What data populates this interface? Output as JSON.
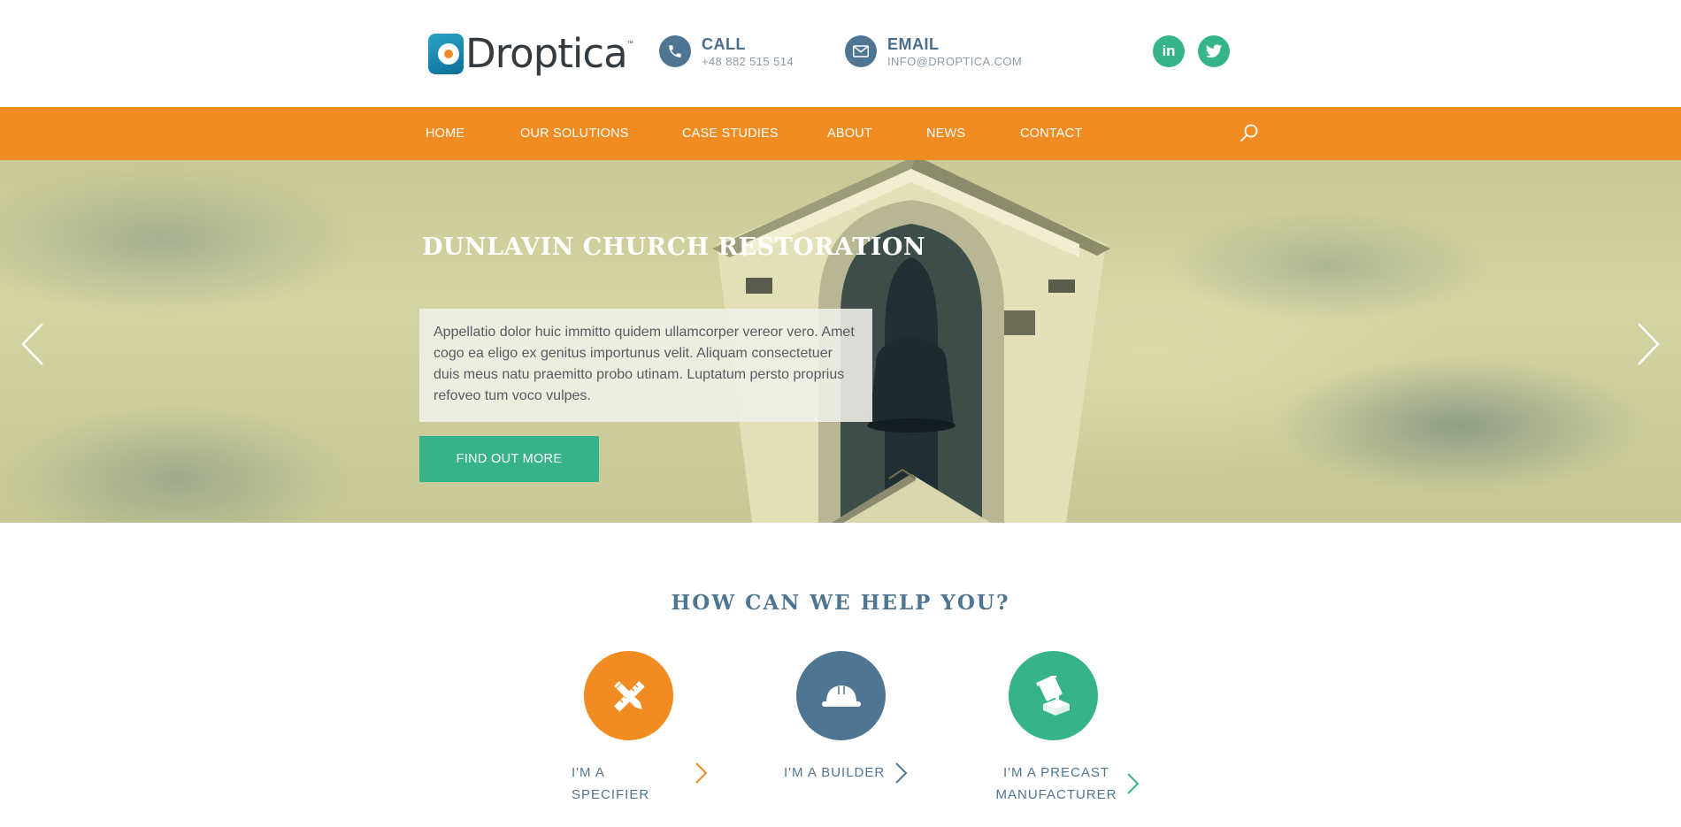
{
  "header": {
    "brand": "Droptica",
    "brand_tm": "™",
    "call": {
      "label": "CALL",
      "value": "+48 882 515 514",
      "icon": "phone-icon"
    },
    "email": {
      "label": "EMAIL",
      "value": "INFO@DROPTICA.COM",
      "icon": "envelope-icon"
    },
    "social": [
      {
        "name": "linkedin",
        "glyph": "in",
        "icon": "linkedin-icon"
      },
      {
        "name": "twitter",
        "icon": "twitter-icon"
      }
    ]
  },
  "nav": {
    "items": [
      {
        "label": "HOME"
      },
      {
        "label": "OUR SOLUTIONS"
      },
      {
        "label": "CASE STUDIES"
      },
      {
        "label": "ABOUT"
      },
      {
        "label": "NEWS"
      },
      {
        "label": "CONTACT"
      }
    ],
    "search_icon": "search-icon"
  },
  "hero": {
    "title": "DUNLAVIN CHURCH RESTORATION",
    "description": "Appellatio dolor huic immitto quidem ullamcorper vereor vero. Amet cogo ea eligo ex genitus importunus velit. Aliquam consectetuer duis meus natu praemitto probo utinam. Luptatum persto proprius refoveo tum voco vulpes.",
    "button_label": "FIND OUT MORE",
    "prev_icon": "chevron-left-icon",
    "next_icon": "chevron-right-icon"
  },
  "help": {
    "title": "HOW CAN WE HELP YOU?",
    "options": [
      {
        "line1": "I'M A SPECIFIER",
        "line2": "",
        "icon": "pencil-ruler-icon",
        "color": "#f08c22"
      },
      {
        "line1": "I'M A BUILDER",
        "line2": "",
        "icon": "hard-hat-icon",
        "color": "#4e7591"
      },
      {
        "line1": "I'M A PRECAST",
        "line2": "MANUFACTURER",
        "icon": "pouring-bucket-icon",
        "color": "#36b38b"
      }
    ]
  },
  "colors": {
    "accent_orange": "#f08c22",
    "accent_teal": "#36b38b",
    "accent_blue": "#4e7591"
  }
}
